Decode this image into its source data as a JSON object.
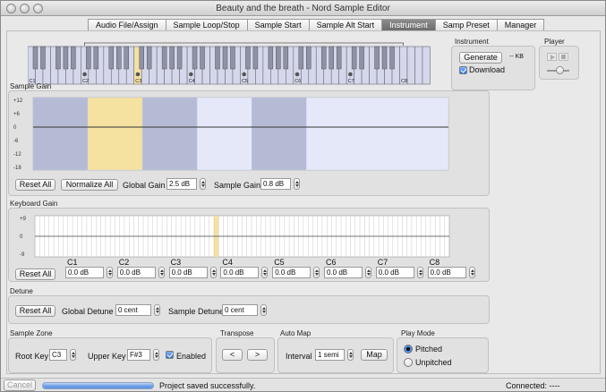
{
  "window": {
    "title": "Beauty and the breath - Nord Sample Editor"
  },
  "tabs": [
    {
      "label": "Audio File/Assign",
      "active": false
    },
    {
      "label": "Sample Loop/Stop",
      "active": false
    },
    {
      "label": "Sample Start",
      "active": false
    },
    {
      "label": "Sample Alt Start",
      "active": false
    },
    {
      "label": "Instrument",
      "active": true
    },
    {
      "label": "Samp Preset",
      "active": false
    },
    {
      "label": "Manager",
      "active": false
    }
  ],
  "keyboard": {
    "octave_labels": [
      "C1",
      "C2",
      "C3",
      "C4",
      "C5",
      "C6",
      "C7",
      "C8"
    ],
    "marked_octaves": [
      "C2",
      "C3",
      "C4",
      "C5",
      "C6",
      "C7"
    ],
    "highlighted_octave": "C3"
  },
  "instrument": {
    "group_label": "Instrument",
    "generate_label": "Generate",
    "size_text": "-- KB",
    "download_label": "Download",
    "download_checked": true
  },
  "player": {
    "group_label": "Player",
    "play_icon": "play-icon",
    "stop_icon": "stop-icon"
  },
  "sample_gain": {
    "section_label": "Sample Gain",
    "y_ticks": [
      "+12",
      "+6",
      "0",
      "-6",
      "-12",
      "-18"
    ],
    "zones": [
      {
        "color": "#b6bbd5"
      },
      {
        "color": "#f5e1a0"
      },
      {
        "color": "#b6bbd5"
      },
      {
        "color": "#e4e8f8"
      },
      {
        "color": "#b6bbd5"
      },
      {
        "color": "#e4e8f8"
      }
    ],
    "reset_all_label": "Reset All",
    "normalize_all_label": "Normalize All",
    "global_gain_label": "Global Gain",
    "global_gain_value": "2.5 dB",
    "sample_gain_label": "Sample Gain",
    "sample_gain_value": "0.8 dB"
  },
  "keyboard_gain": {
    "section_label": "Keyboard Gain",
    "y_ticks": [
      "+9",
      "0",
      "-9"
    ],
    "highlight_key_index": 38,
    "reset_all_label": "Reset All",
    "octaves": [
      {
        "label": "C1",
        "value": "0.0 dB"
      },
      {
        "label": "C2",
        "value": "0.0 dB"
      },
      {
        "label": "C3",
        "value": "0.0 dB"
      },
      {
        "label": "C4",
        "value": "0.0 dB"
      },
      {
        "label": "C5",
        "value": "0.0 dB"
      },
      {
        "label": "C6",
        "value": "0.0 dB"
      },
      {
        "label": "C7",
        "value": "0.0 dB"
      },
      {
        "label": "C8",
        "value": "0.0 dB"
      }
    ]
  },
  "detune": {
    "section_label": "Detune",
    "reset_all_label": "Reset All",
    "global_detune_label": "Global Detune",
    "global_detune_value": "0 cent",
    "sample_detune_label": "Sample Detune",
    "sample_detune_value": "0 cent"
  },
  "sample_zone": {
    "section_label": "Sample Zone",
    "root_key_label": "Root Key",
    "root_key_value": "C3",
    "upper_key_label": "Upper Key",
    "upper_key_value": "F#3",
    "enabled_label": "Enabled",
    "enabled_checked": true
  },
  "transpose": {
    "section_label": "Transpose",
    "down_label": "<",
    "up_label": ">"
  },
  "auto_map": {
    "section_label": "Auto Map",
    "interval_label": "Interval",
    "interval_value": "1 semi",
    "map_label": "Map"
  },
  "play_mode": {
    "section_label": "Play Mode",
    "options": [
      {
        "label": "Pitched",
        "selected": true
      },
      {
        "label": "Unpitched",
        "selected": false
      }
    ]
  },
  "status_bar": {
    "cancel_label": "Cancel",
    "progress_fraction": 1.0,
    "message": "Project saved successfully.",
    "connection": "Connected: ----"
  },
  "colors": {
    "accent": "#2f72d9",
    "gain_line": "#333333",
    "highlight": "#f5e1a0"
  }
}
